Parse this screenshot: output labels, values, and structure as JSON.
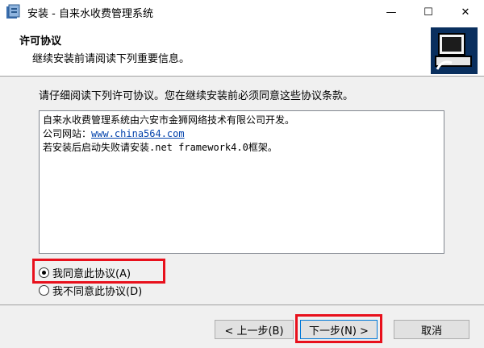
{
  "window": {
    "title": "安装 - 自来水收费管理系统",
    "min_glyph": "—",
    "max_glyph": "☐",
    "close_glyph": "✕"
  },
  "header": {
    "title": "许可协议",
    "subtitle": "继续安装前请阅读下列重要信息。"
  },
  "main": {
    "intro": "请仔细阅读下列许可协议。您在继续安装前必须同意这些协议条款。",
    "license": {
      "line1": "自来水收费管理系统由六安市金狮网络技术有限公司开发。",
      "line2_label": "公司网站：",
      "line2_link": "www.china564.com",
      "line3": "若安装后启动失败请安装.net framework4.0框架。"
    },
    "radio_agree": "我同意此协议(A)",
    "radio_disagree": "我不同意此协议(D)"
  },
  "buttons": {
    "back": "< 上一步(B)",
    "next": "下一步(N) >",
    "cancel": "取消"
  },
  "colors": {
    "highlight": "#e8101c",
    "link": "#0645ad",
    "focus": "#0078d7"
  }
}
